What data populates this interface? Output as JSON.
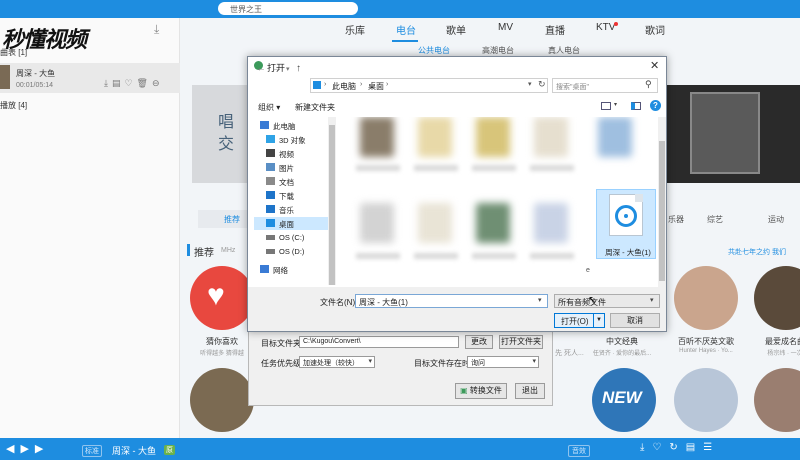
{
  "app": {
    "logo": "秒懂视频",
    "top_search": "世界之王",
    "nav_tabs": [
      "乐库",
      "电台",
      "歌单",
      "MV",
      "直播",
      "KTV",
      "歌词"
    ],
    "subtabs": [
      "公共电台",
      "高潮电台",
      "真人电台"
    ],
    "left_labels": {
      "favorites": "曲表",
      "favorites_count": "[1]",
      "recent": "播放",
      "recent_count": "[4]"
    },
    "song_row": {
      "title": "周深 - 大鱼",
      "time": "00:01/05:14"
    },
    "banner_text": "唱交",
    "categories": [
      "推荐",
      "乐器",
      "综艺",
      "运动"
    ],
    "recommend": {
      "title": "推荐",
      "sub": "MHz",
      "link": "共赴七年之约 我们"
    },
    "circle_row1": [
      {
        "title": "猜你喜欢",
        "sub": "听得越多 猜得越"
      },
      {
        "title": "中文经典",
        "sub": "任贤齐 · 爱你的最后..."
      },
      {
        "title": "百听不厌英文歌",
        "sub": "Hunter Hayes · Yo..."
      },
      {
        "title": "最爱成名曲",
        "sub": "杨宗纬 · 一次"
      }
    ],
    "new_badge": "NEW",
    "bottom": {
      "badge": "标准",
      "song": "周深 - 大鱼",
      "tag": "原",
      "right_badge": "音效"
    }
  },
  "converter": {
    "target_label": "目标文件夹",
    "target_value": "C:\\Kugou\\Convert\\",
    "change_btn": "更改",
    "open_folder_btn": "打开文件夹",
    "priority_label": "任务优先级",
    "priority_value": "加速处理（较快）",
    "exists_label": "目标文件存在时",
    "exists_value": "询问",
    "convert_btn": "转换文件",
    "exit_btn": "退出",
    "partial_text": "先 死人..."
  },
  "dialog": {
    "title": "打开",
    "breadcrumb": [
      "此电脑",
      "桌面"
    ],
    "search_placeholder": "搜索\"桌面\"",
    "organize": "组织 ▾",
    "new_folder": "新建文件夹",
    "help": "?",
    "tree": [
      {
        "label": "此电脑",
        "icon": "computer-icon",
        "color": "#3a7bd5"
      },
      {
        "label": "3D 对象",
        "icon": "cube-icon",
        "color": "#2fa3e6"
      },
      {
        "label": "视频",
        "icon": "video-icon",
        "color": "#444444"
      },
      {
        "label": "图片",
        "icon": "picture-icon",
        "color": "#5a8fc5"
      },
      {
        "label": "文档",
        "icon": "document-icon",
        "color": "#8a8a8a"
      },
      {
        "label": "下载",
        "icon": "download-icon",
        "color": "#1e74c9"
      },
      {
        "label": "音乐",
        "icon": "music-icon",
        "color": "#1e74c9"
      },
      {
        "label": "桌面",
        "icon": "desktop-icon",
        "color": "#1e8de0",
        "selected": true
      },
      {
        "label": "OS (C:)",
        "icon": "drive-icon",
        "color": "#777777"
      },
      {
        "label": "OS (D:)",
        "icon": "drive-icon",
        "color": "#777777"
      },
      {
        "label": "网络",
        "icon": "network-icon",
        "color": "#3a7bd5"
      }
    ],
    "selected_file": "周深 - 大鱼(1)",
    "filename_label": "文件名(N):",
    "filename_value": "周深 - 大鱼(1)",
    "filetype_value": "所有音频文件",
    "open_btn": "打开(O)",
    "cancel_btn": "取消",
    "file_fragment": "e"
  },
  "colors": {
    "accent": "#1e8de0",
    "selection": "#cce8ff"
  }
}
